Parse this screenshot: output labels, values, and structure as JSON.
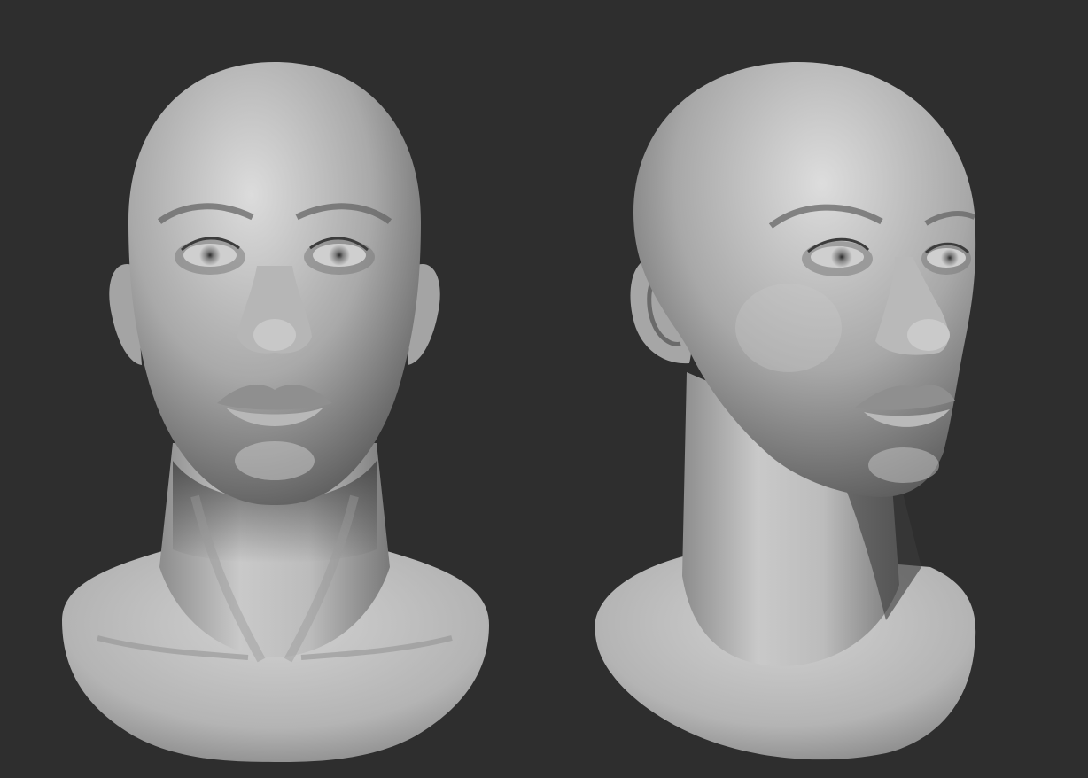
{
  "scene": {
    "background_color": "#2e2e2e",
    "material_base_color": "#bdbdbd",
    "shadow_color": "#3a3a3a",
    "highlight_color": "#e6e6e6",
    "views": [
      {
        "name": "front",
        "icon": "sculpted-female-head-front-view"
      },
      {
        "name": "three-quarter",
        "icon": "sculpted-female-head-three-quarter-view"
      }
    ]
  }
}
